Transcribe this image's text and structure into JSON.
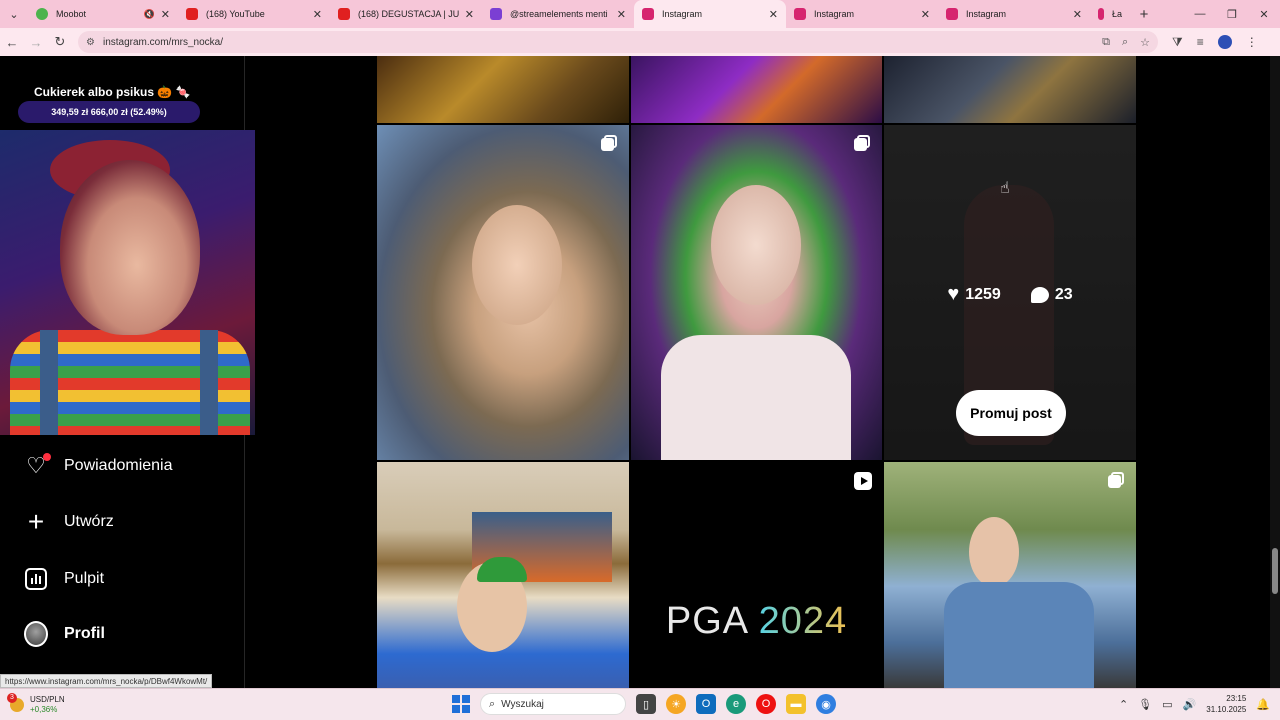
{
  "browser": {
    "tabs": [
      {
        "title": "Moobot",
        "active": false,
        "fav_color": "#4db34d"
      },
      {
        "title": "(168) YouTube",
        "active": false,
        "fav_color": "#e02020"
      },
      {
        "title": "(168) DEGUSTACJA | JUŻ WID",
        "active": false,
        "fav_color": "#e02020"
      },
      {
        "title": "@streamelements menti",
        "active": false,
        "fav_color": "#7b3fd3"
      },
      {
        "title": "Instagram",
        "active": true,
        "fav_color": "#d6256f"
      },
      {
        "title": "Instagram",
        "active": false,
        "fav_color": "#d6256f"
      },
      {
        "title": "Instagram",
        "active": false,
        "fav_color": "#d6256f"
      },
      {
        "title": "Ła",
        "active": false,
        "fav_color": "#d6256f"
      }
    ],
    "url": "instagram.com/mrs_nocka/"
  },
  "overlay": {
    "title": "Cukierek albo psikus 🎃 🍬",
    "progress_text": "349,59 zł  666,00 zł (52.49%)",
    "progress": 0.5249
  },
  "sidebar": {
    "items": [
      {
        "label": "Powiadomienia",
        "icon": "heart-icon",
        "has_dot": true
      },
      {
        "label": "Utwórz",
        "icon": "plus-icon"
      },
      {
        "label": "Pulpit",
        "icon": "dashboard-icon"
      },
      {
        "label": "Profil",
        "icon": "avatar-icon"
      }
    ]
  },
  "posts": {
    "hovered": {
      "likes": "1259",
      "comments": "23",
      "promote_label": "Promuj post"
    },
    "pga_label": "PGA",
    "pga_year": "2024"
  },
  "status_url": "https://www.instagram.com/mrs_nocka/p/DBwf4WkowMt/",
  "taskbar": {
    "ticker_name": "USD/PLN",
    "ticker_change": "+0,36%",
    "ticker_badge": "3",
    "search_placeholder": "Wyszukaj",
    "time": "23:15",
    "date": "31.10.2025"
  }
}
